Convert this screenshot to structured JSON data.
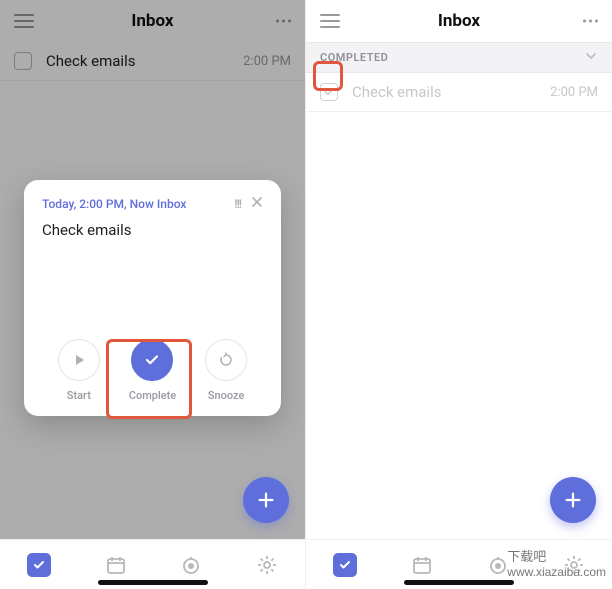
{
  "colors": {
    "accent": "#5e6edb",
    "highlight": "#e1573e"
  },
  "left": {
    "header": {
      "title": "Inbox"
    },
    "task": {
      "title": "Check emails",
      "time": "2:00 PM"
    },
    "modal": {
      "meta": "Today, 2:00 PM, Now",
      "meta_tag": "Inbox",
      "title": "Check emails",
      "actions": {
        "start": "Start",
        "complete": "Complete",
        "snooze": "Snooze"
      }
    }
  },
  "right": {
    "header": {
      "title": "Inbox"
    },
    "section": {
      "label": "COMPLETED"
    },
    "task": {
      "title": "Check emails",
      "time": "2:00 PM"
    }
  },
  "watermark": {
    "cn": "下载吧",
    "url": "www.xiazaiba.com"
  }
}
